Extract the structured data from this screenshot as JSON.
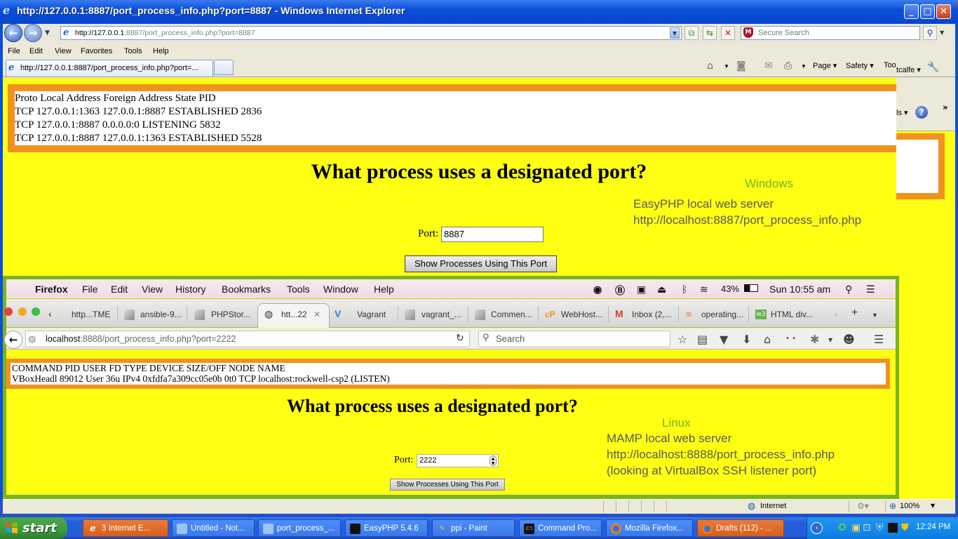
{
  "ie_window": {
    "title": "http://127.0.0.1:8887/port_process_info.php?port=8887 - Windows Internet Explorer",
    "address_host": "http://127.0.0.1",
    "address_rest": ":8887/port_process_info.php?port=8887",
    "search_placeholder": "Secure Search",
    "menu": [
      "File",
      "Edit",
      "View",
      "Favorites",
      "Tools",
      "Help"
    ],
    "tab_label": "http://127.0.0.1:8887/port_process_info.php?port=...",
    "command_bar": {
      "page": "Page ▾",
      "safety": "Safety ▾",
      "tools": "Too",
      "overflow_user": "tcalfe ▾",
      "overflow_tools": "ls ▾"
    },
    "status": {
      "zone": "Internet",
      "zoom": "100%"
    }
  },
  "windows_page": {
    "output_lines": [
      "Proto Local Address Foreign Address State PID",
      "TCP 127.0.0.1:1363 127.0.0.1:8887 ESTABLISHED 2836",
      "TCP 127.0.0.1:8887 0.0.0.0:0 LISTENING 5832",
      "TCP 127.0.0.1:8887 127.0.0.1:1363 ESTABLISHED 5528"
    ],
    "heading": "What process uses a designated port?",
    "port_label": "Port:",
    "port_value": "8887",
    "button": "Show Processes Using This Port",
    "annotation_title": "Windows",
    "annotation_lines": [
      "EasyPHP local web server",
      "http://localhost:8887/port_process_info.php"
    ]
  },
  "mac_window": {
    "menubar": {
      "app": "Firefox",
      "items": [
        "File",
        "Edit",
        "View",
        "History",
        "Bookmarks",
        "Tools",
        "Window",
        "Help"
      ],
      "battery": "43%",
      "clock": "Sun 10:55 am"
    },
    "tabs": [
      {
        "label": "http...TME"
      },
      {
        "label": "ansible-9..."
      },
      {
        "label": "PHPStor..."
      },
      {
        "label": "htt...22",
        "active": true
      },
      {
        "label": "Vagrant"
      },
      {
        "label": "vagrant_..."
      },
      {
        "label": "Commen..."
      },
      {
        "label": "WebHost..."
      },
      {
        "label": "Inbox (2,..."
      },
      {
        "label": "operating..."
      },
      {
        "label": "HTML div..."
      }
    ],
    "url_host": "localhost",
    "url_rest": ":8888/port_process_info.php?port=2222",
    "search_placeholder": "Search"
  },
  "linux_page": {
    "output_lines": [
      "COMMAND PID USER FD TYPE DEVICE SIZE/OFF NODE NAME",
      "VBoxHeadl 89012 User 36u IPv4 0xfdfa7a309cc05e0b 0t0 TCP localhost:rockwell-csp2 (LISTEN)"
    ],
    "heading": "What process uses a designated port?",
    "port_label": "Port:",
    "port_value": "2222",
    "button": "Show Processes Using This Port",
    "annotation_title": "Linux",
    "annotation_lines": [
      "MAMP local web server",
      "http://localhost:8888/port_process_info.php",
      "(looking at VirtualBox SSH listener port)"
    ]
  },
  "taskbar": {
    "start": "start",
    "items": [
      {
        "label": "3 Internet E...",
        "active": true
      },
      {
        "label": "Untitled - Not..."
      },
      {
        "label": "port_process_..."
      },
      {
        "label": "EasyPHP 5.4.6"
      },
      {
        "label": "ppi - Paint"
      },
      {
        "label": "Command Pro..."
      },
      {
        "label": "Mozilla Firefox..."
      },
      {
        "label": "Drafts (112) - ...",
        "active": true
      }
    ],
    "clock": "12:24 PM"
  },
  "colors": {
    "page_bg": "#ffff14",
    "orange_border": "#f2911e",
    "green_border": "#78b41e",
    "xp_blue": "#245edb"
  }
}
